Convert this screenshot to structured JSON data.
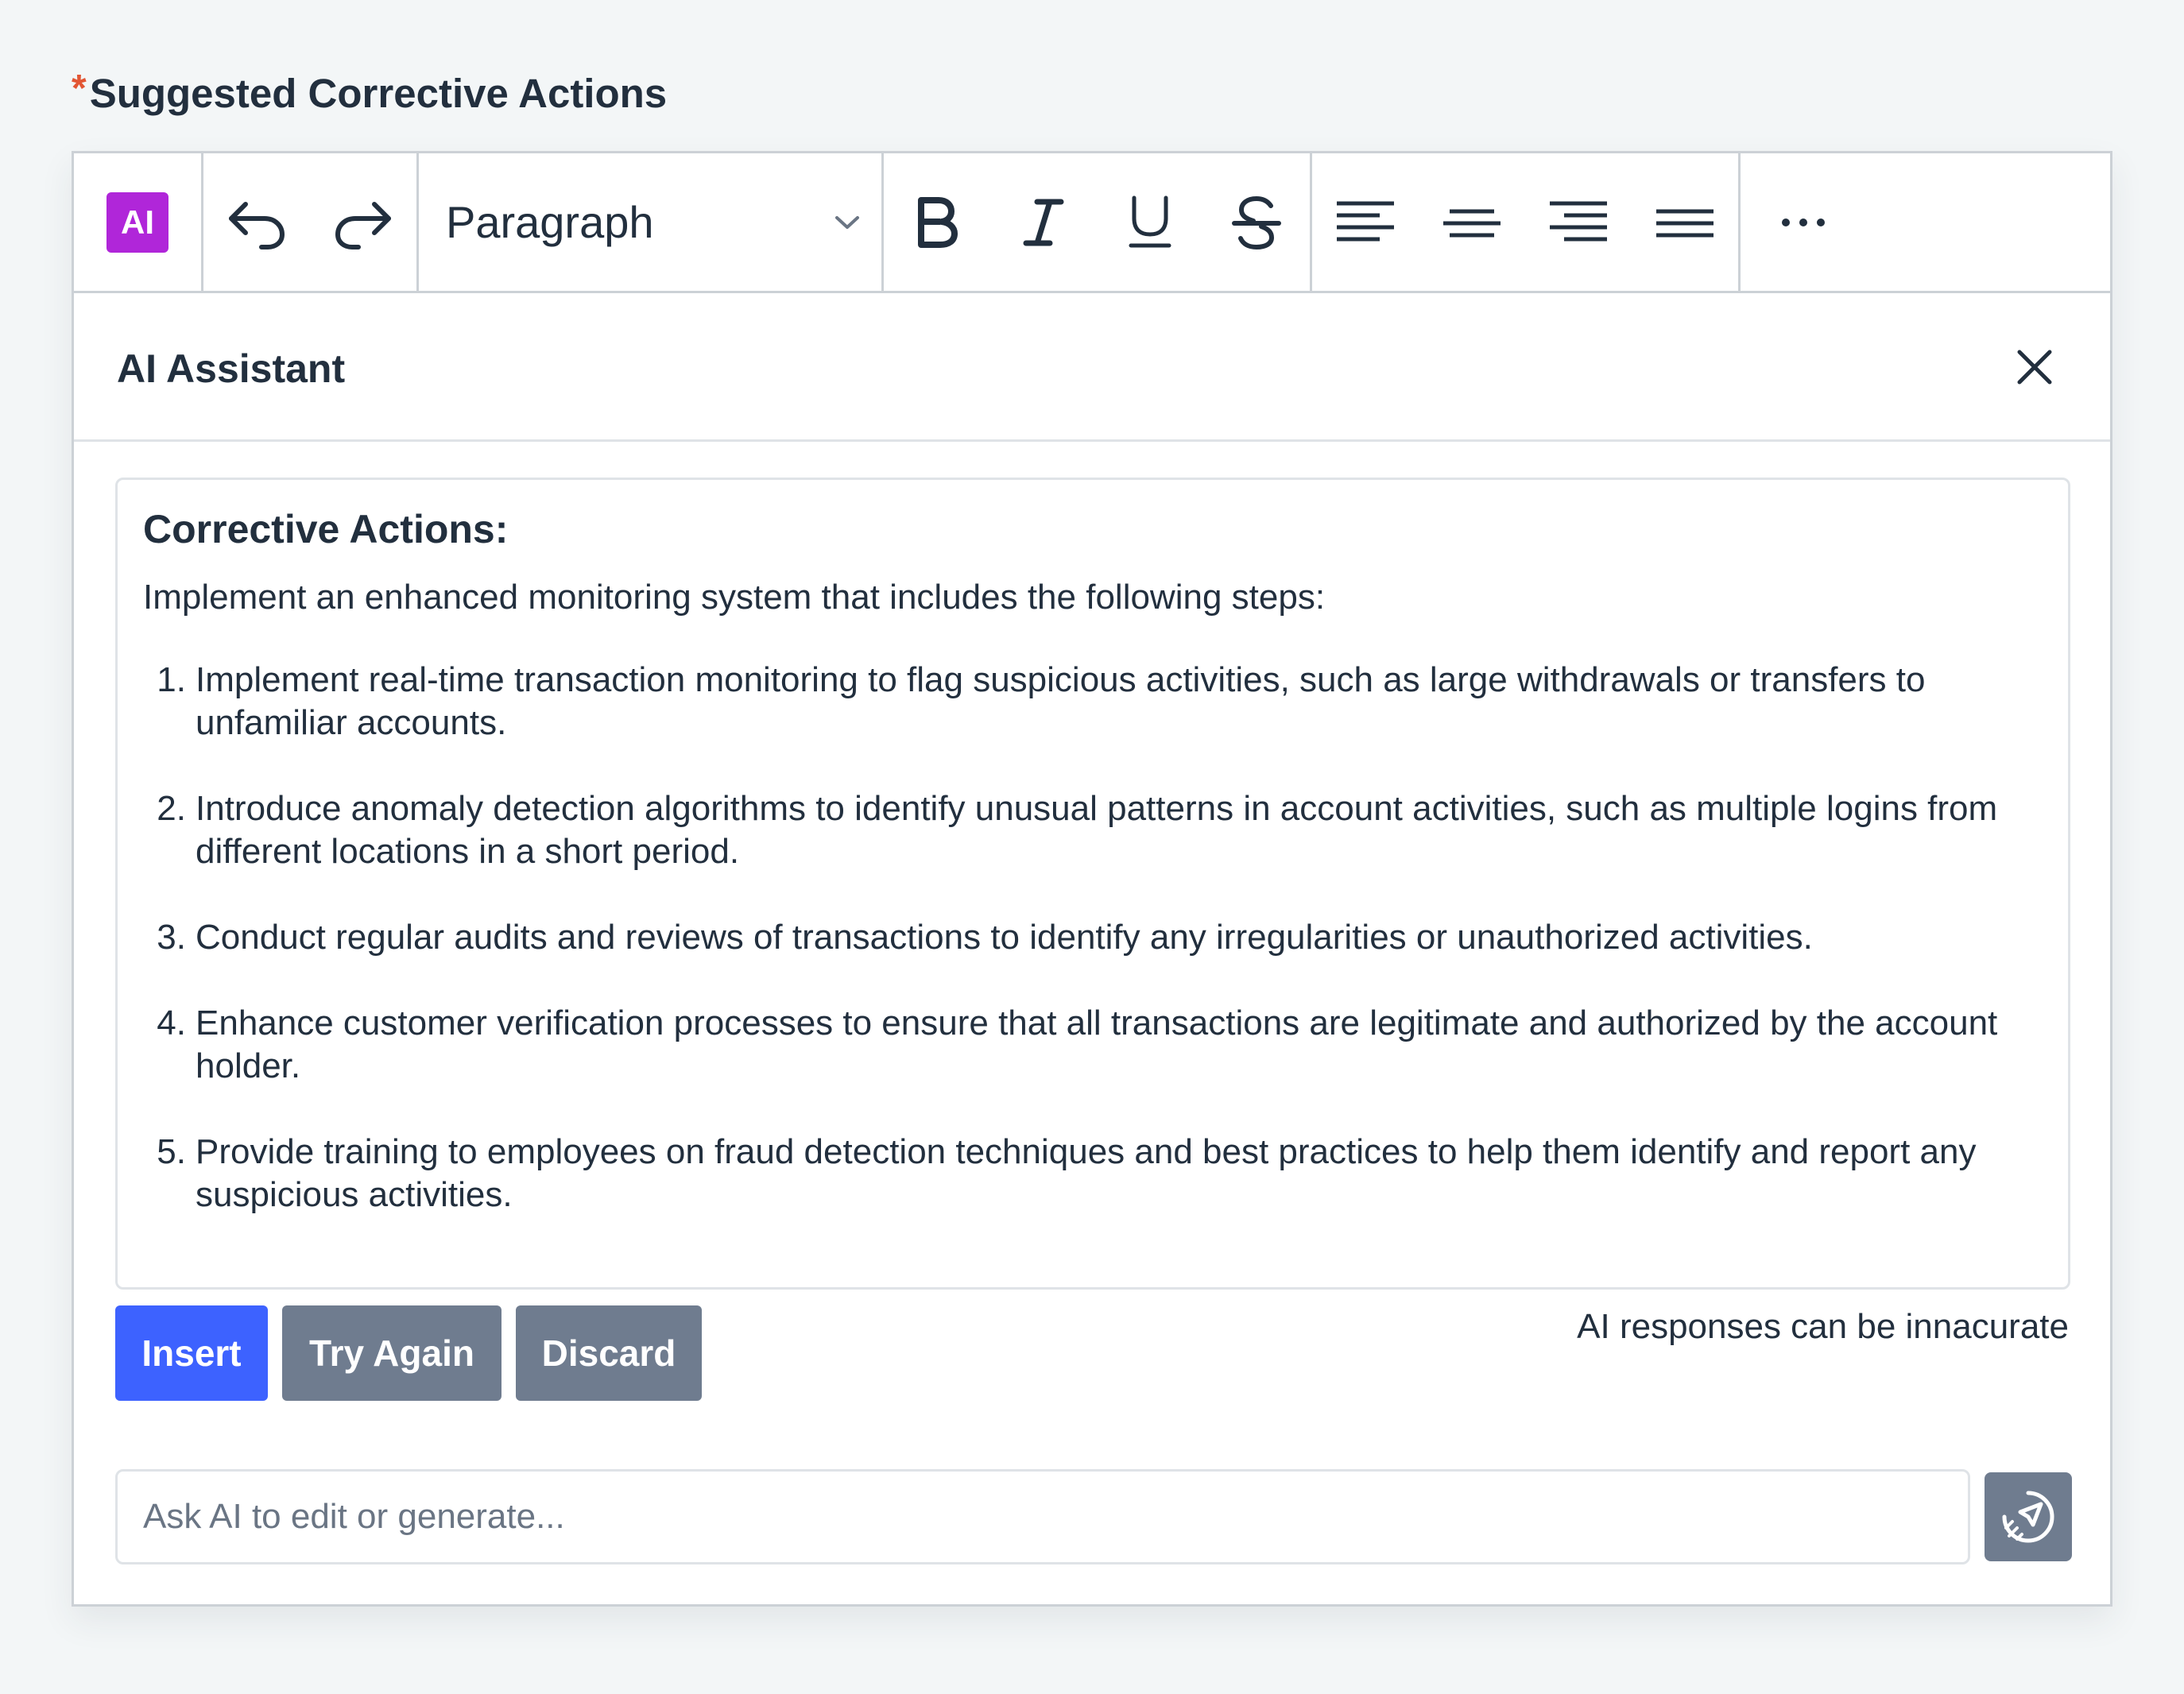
{
  "field": {
    "required_marker": "*",
    "label": "Suggested Corrective Actions"
  },
  "toolbar": {
    "ai_button_label": "AI",
    "block_format": "Paragraph",
    "icons": [
      "ai-icon",
      "undo-icon",
      "redo-icon",
      "chevron-down-icon",
      "bold-icon",
      "italic-icon",
      "underline-icon",
      "strikethrough-icon",
      "align-left-icon",
      "align-center-icon",
      "align-right-icon",
      "align-justify-icon",
      "more-icon"
    ]
  },
  "ai_panel": {
    "title": "AI Assistant",
    "response": {
      "heading": "Corrective Actions:",
      "intro": "Implement an enhanced monitoring system that includes the following steps:",
      "items": [
        {
          "num": "1.",
          "text": "Implement real-time transaction monitoring to flag suspicious activities, such as large withdrawals or transfers to unfamiliar accounts."
        },
        {
          "num": "2.",
          "text": "Introduce anomaly detection algorithms to identify unusual patterns in account activities, such as multiple logins from different locations in a short period."
        },
        {
          "num": "3.",
          "text": "Conduct regular audits and reviews of transactions to identify any irregularities or unauthorized activities."
        },
        {
          "num": "4.",
          "text": "Enhance customer verification processes to ensure that all transactions are legitimate and authorized by the account holder."
        },
        {
          "num": "5.",
          "text": "Provide training to employees on fraud detection techniques and best practices to help them identify and report any suspicious activities."
        }
      ]
    },
    "buttons": {
      "insert": "Insert",
      "try_again": "Try Again",
      "discard": "Discard"
    },
    "disclaimer": "AI responses can be innacurate",
    "prompt": {
      "value": "",
      "placeholder": "Ask AI to edit or generate..."
    }
  },
  "colors": {
    "ai_badge": "#b026d9",
    "primary_button": "#3d62ff",
    "secondary_button": "#6f7c8f",
    "required": "#e25634"
  }
}
